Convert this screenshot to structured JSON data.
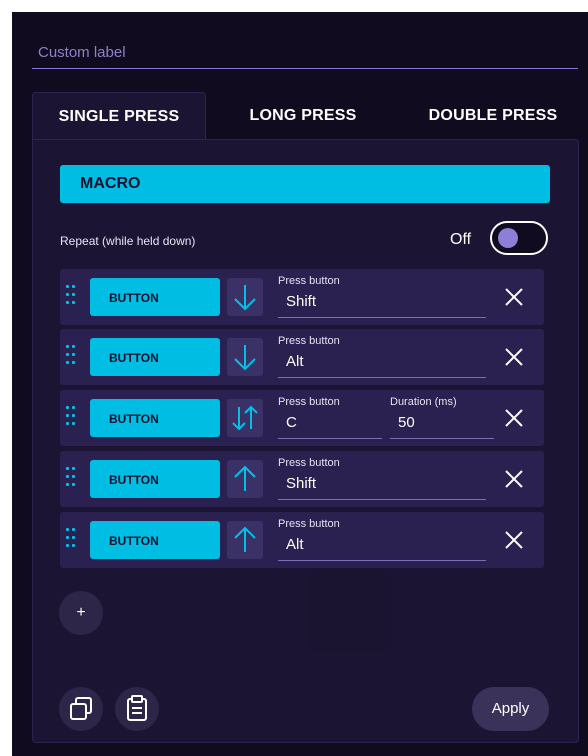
{
  "custom_label": {
    "placeholder": "Custom label"
  },
  "tabs": [
    {
      "label": "SINGLE PRESS",
      "active": true
    },
    {
      "label": "LONG PRESS",
      "active": false
    },
    {
      "label": "DOUBLE PRESS",
      "active": false
    }
  ],
  "action_type": "MACRO",
  "repeat": {
    "label": "Repeat (while held down)",
    "state_label": "Off",
    "enabled": false
  },
  "steps": [
    {
      "type_label": "BUTTON",
      "direction": "down",
      "press_label": "Press button",
      "press_value": "Shift"
    },
    {
      "type_label": "BUTTON",
      "direction": "down",
      "press_label": "Press button",
      "press_value": "Alt"
    },
    {
      "type_label": "BUTTON",
      "direction": "down-up",
      "press_label": "Press button",
      "press_value": "C",
      "duration_label": "Duration (ms)",
      "duration_value": "50"
    },
    {
      "type_label": "BUTTON",
      "direction": "up",
      "press_label": "Press button",
      "press_value": "Shift"
    },
    {
      "type_label": "BUTTON",
      "direction": "up",
      "press_label": "Press button",
      "press_value": "Alt"
    }
  ],
  "add_label": "+",
  "icons": {
    "drag": "drag-handle-icon",
    "down": "arrow-down-icon",
    "up": "arrow-up-icon",
    "down_up": "arrow-down-up-icon",
    "remove": "close-icon",
    "copy": "copy-icon",
    "paste": "clipboard-icon"
  },
  "apply_label": "Apply",
  "colors": {
    "accent": "#00bde3",
    "background": "#100b1f",
    "panel": "#1b1433",
    "row": "#2a2150",
    "toggle_knob": "#8e7fd6"
  }
}
